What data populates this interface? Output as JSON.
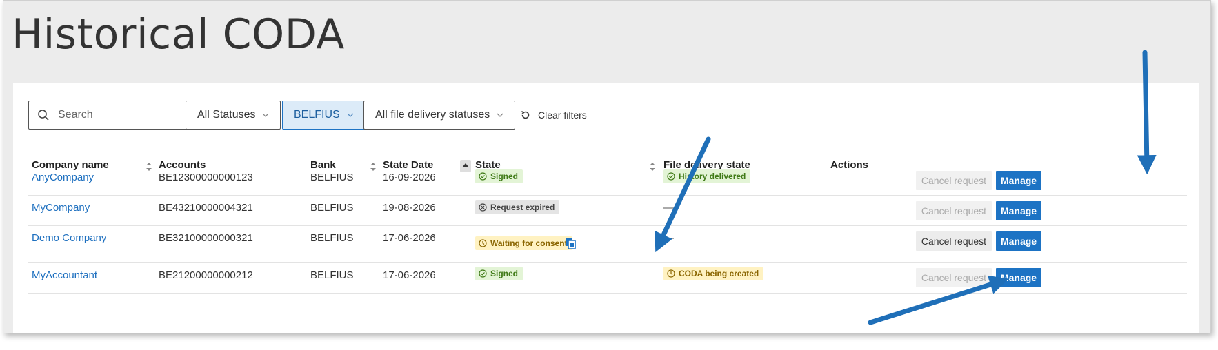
{
  "page": {
    "title": "Historical CODA"
  },
  "filters": {
    "search_placeholder": "Search",
    "status_dropdown": "All Statuses",
    "bank_dropdown": "BELFIUS",
    "delivery_dropdown": "All file delivery statuses",
    "clear_filters": "Clear filters"
  },
  "table": {
    "headers": {
      "company": "Company name",
      "accounts": "Accounts",
      "bank": "Bank",
      "state_date": "State Date",
      "state": "State",
      "delivery": "File delivery state",
      "actions": "Actions"
    },
    "rows": [
      {
        "company": "AnyCompany",
        "account": "BE12300000000123",
        "bank": "BELFIUS",
        "date": "16-09-2026",
        "state": "Signed",
        "delivery": "History delivered",
        "cancel": "Cancel request",
        "manage": "Manage"
      },
      {
        "company": "MyCompany",
        "account": "BE43210000004321",
        "bank": "BELFIUS",
        "date": "19-08-2026",
        "state": "Request expired",
        "delivery": "—",
        "cancel": "Cancel request",
        "manage": "Manage"
      },
      {
        "company": "Demo Company",
        "account": "BE32100000000321",
        "bank": "BELFIUS",
        "date": "17-06-2026",
        "state": "Waiting for consent",
        "delivery": "—",
        "cancel": "Cancel request",
        "manage": "Manage"
      },
      {
        "company": "MyAccountant",
        "account": "BE21200000000212",
        "bank": "BELFIUS",
        "date": "17-06-2026",
        "state": "Signed",
        "delivery": "CODA being created",
        "cancel": "Cancel request",
        "manage": "Manage"
      }
    ]
  },
  "colors": {
    "primary": "#1d73c4",
    "signed_bg": "#e3f4d6",
    "waiting_bg": "#fff2c2",
    "expired_bg": "#e4e4e4",
    "annotation_arrow": "#1f6fb8"
  },
  "icons": [
    "search-icon",
    "chevron-down-icon",
    "refresh-icon",
    "sort-icon",
    "check-circle-icon",
    "x-circle-icon",
    "clock-icon",
    "copy-icon"
  ]
}
